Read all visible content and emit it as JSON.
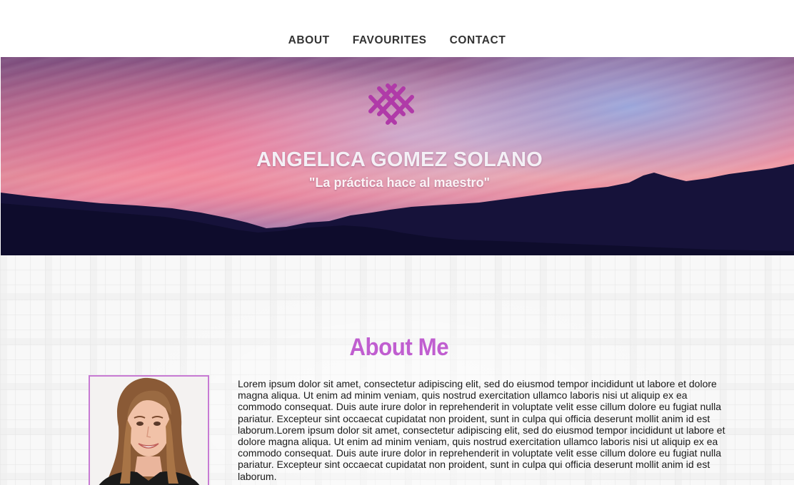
{
  "nav": {
    "items": [
      {
        "label": "ABOUT"
      },
      {
        "label": "FAVOURITES"
      },
      {
        "label": "CONTACT"
      }
    ]
  },
  "hero": {
    "logo_icon": "interlaced-x-logo-icon",
    "name": "ANGELICA GOMEZ SOLANO",
    "motto": "\"La práctica hace al maestro\""
  },
  "about": {
    "title": "About Me",
    "photo": "portrait-photo",
    "bio": "Lorem ipsum dolor sit amet, consectetur adipiscing elit, sed do eiusmod tempor incididunt ut labore et dolore magna aliqua. Ut enim ad minim veniam, quis nostrud exercitation ullamco laboris nisi ut aliquip ex ea commodo consequat. Duis aute irure dolor in reprehenderit in voluptate velit esse cillum dolore eu fugiat nulla pariatur. Excepteur sint occaecat cupidatat non proident, sunt in culpa qui officia deserunt mollit anim id est laborum.Lorem ipsum dolor sit amet, consectetur adipiscing elit, sed do eiusmod tempor incididunt ut labore et dolore magna aliqua. Ut enim ad minim veniam, quis nostrud exercitation ullamco laboris nisi ut aliquip ex ea commodo consequat. Duis aute irure dolor in reprehenderit in voluptate velit esse cillum dolore eu fugiat nulla pariatur. Excepteur sint occaecat cupidatat non proident, sunt in culpa qui officia deserunt mollit anim id est laborum."
  },
  "colors": {
    "accent": "#c05ed0",
    "logo": "#b03aa8",
    "nav_text": "#333333"
  }
}
